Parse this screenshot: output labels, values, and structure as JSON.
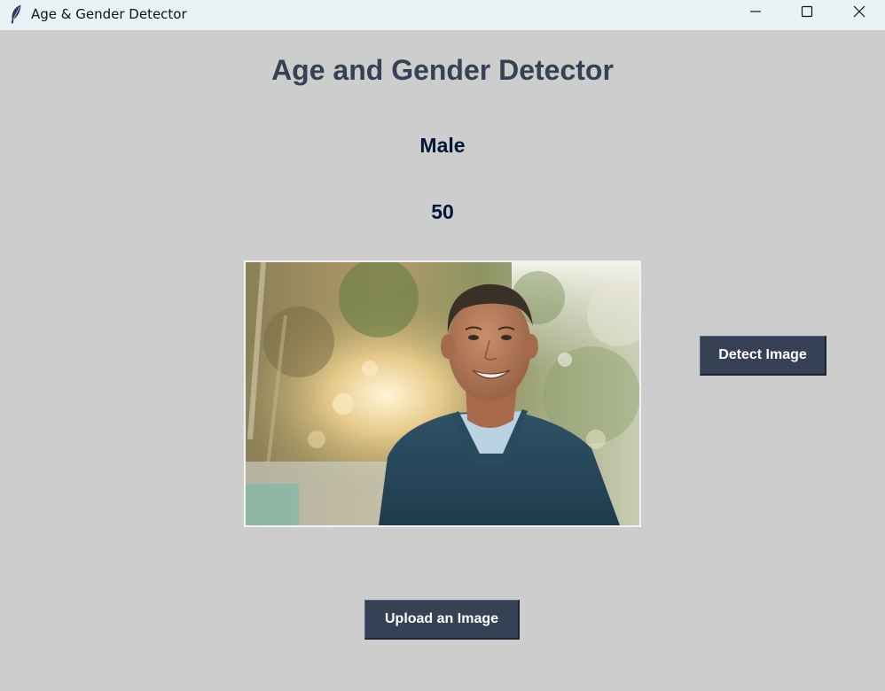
{
  "window": {
    "title": "Age & Gender Detector",
    "icon": "feather-icon",
    "controls": [
      "minimize-icon",
      "maximize-icon",
      "close-icon"
    ]
  },
  "main": {
    "heading": "Age and Gender Detector",
    "gender_result": "Male",
    "age_result": "50",
    "photo": "smiling man in a dark blue v-neck sweater outdoors"
  },
  "buttons": {
    "detect_label": "Detect Image",
    "upload_label": "Upload an Image"
  },
  "colors": {
    "background": "#cdcdcd",
    "heading": "#364156",
    "result_text": "#011638",
    "button_bg": "#364156",
    "button_fg": "#ffffff",
    "titlebar": "#e9f3f6"
  }
}
